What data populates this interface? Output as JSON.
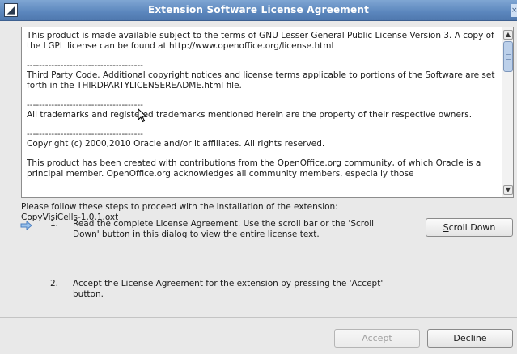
{
  "window": {
    "title": "Extension Software License Agreement",
    "app_icon": "document-app-icon",
    "close_icon": "close-icon"
  },
  "license": {
    "paragraphs": [
      "This product is made available subject to the terms of GNU Lesser General Public License Version 3. A copy of the LGPL license can be found at http://www.openoffice.org/license.html",
      "Third Party Code. Additional copyright notices and license terms applicable to portions of the Software are set forth in the THIRDPARTYLICENSEREADME.html file.",
      "All trademarks and registered trademarks mentioned herein are the property of their respective owners.",
      "Copyright (c) 2000,2010 Oracle and/or it affiliates. All rights reserved.",
      "This product has been created with contributions from the OpenOffice.org community, of which Oracle is a principal member. OpenOffice.org acknowledges all community members, especially those"
    ],
    "separator": "--------------------------------------"
  },
  "instructions": {
    "intro_line1": "Please follow these steps to proceed with the installation of the extension:",
    "intro_line2": "CopyVisiCells-1.0.1.oxt"
  },
  "steps": [
    {
      "number": "1.",
      "line1": "Read the complete License Agreement. Use the scroll bar or the 'Scroll",
      "line2": "Down' button in this dialog to view the entire license text."
    },
    {
      "number": "2.",
      "line1": "Accept the License Agreement for the extension by pressing the 'Accept'",
      "line2": "button."
    }
  ],
  "buttons": {
    "scroll_down_mnemonic": "S",
    "scroll_down_rest": "croll Down",
    "accept": "Accept",
    "decline": "Decline"
  },
  "colors": {
    "titlebar": "#5b86bd",
    "arrow": "#4a7fc1"
  }
}
